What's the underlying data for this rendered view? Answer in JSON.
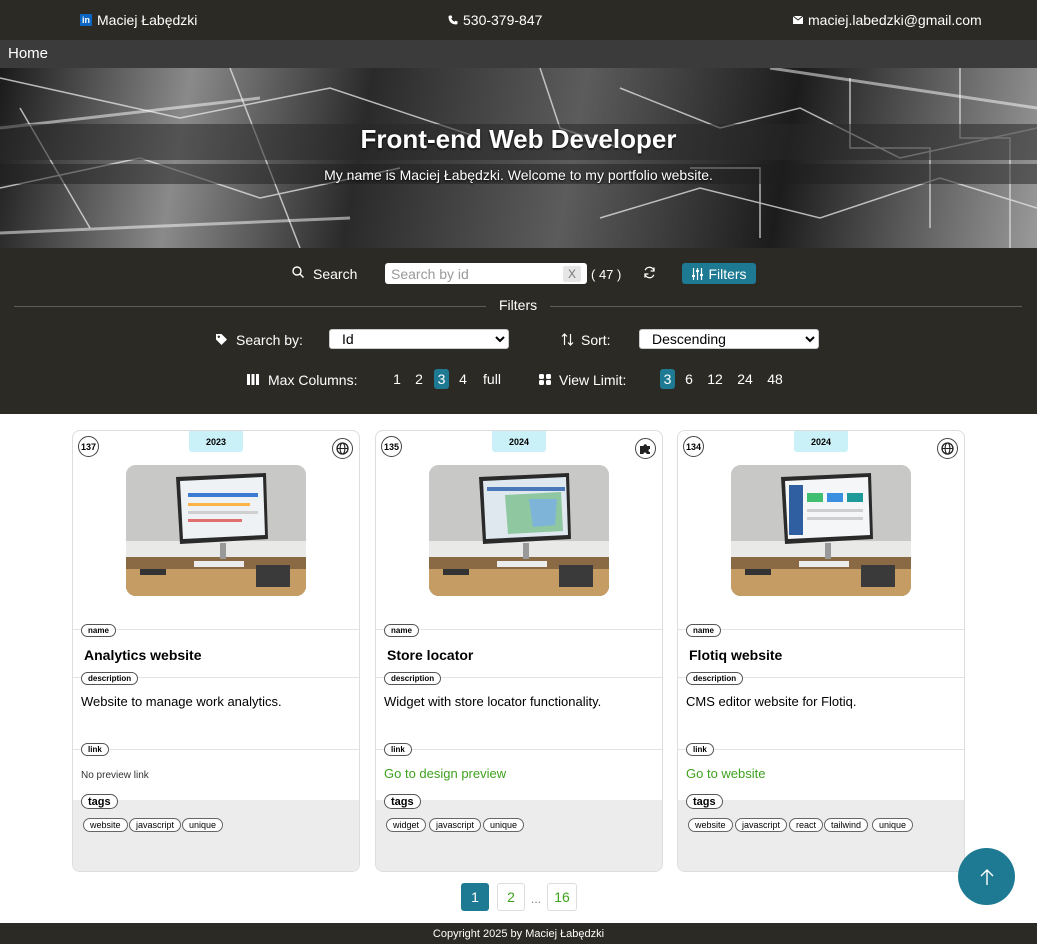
{
  "topbar": {
    "linkedin_icon": "linkedin-icon",
    "name": "Maciej Łabędzki",
    "phone_icon": "phone-icon",
    "phone": "530-379-847",
    "mail_icon": "envelope-icon",
    "email": "maciej.labedzki@gmail.com"
  },
  "nav": {
    "home": "Home"
  },
  "hero": {
    "title": "Front-end Web Developer",
    "subtitle": "My name is Maciej Łabędzki. Welcome to my portfolio website."
  },
  "controls": {
    "search_label": "Search",
    "search_placeholder": "Search by id",
    "clear_label": "X",
    "count": "( 47 )",
    "filters_button": "Filters",
    "filters_heading": "Filters",
    "search_by_label": "Search by:",
    "search_by_value": "Id",
    "sort_label": "Sort:",
    "sort_value": "Descending",
    "max_columns_label": "Max Columns:",
    "max_columns_options": [
      "1",
      "2",
      "3",
      "4",
      "full"
    ],
    "max_columns_selected": "3",
    "view_limit_label": "View Limit:",
    "view_limit_options": [
      "3",
      "6",
      "12",
      "24",
      "48"
    ],
    "view_limit_selected": "3"
  },
  "field_labels": {
    "name": "name",
    "description": "description",
    "link": "link",
    "tags": "tags"
  },
  "cards": [
    {
      "id": "137",
      "year": "2023",
      "type_icon": "globe-icon",
      "name": "Analytics website",
      "description": "Website to manage work analytics.",
      "link": "No preview link",
      "has_link": false,
      "tags": [
        "website",
        "javascript",
        "unique"
      ]
    },
    {
      "id": "135",
      "year": "2024",
      "type_icon": "puzzle-icon",
      "name": "Store locator",
      "description": "Widget with store locator functionality.",
      "link": "Go to design preview",
      "has_link": true,
      "tags": [
        "widget",
        "javascript",
        "unique"
      ]
    },
    {
      "id": "134",
      "year": "2024",
      "type_icon": "globe-icon",
      "name": "Flotiq website",
      "description": "CMS editor website for Flotiq.",
      "link": "Go to website",
      "has_link": true,
      "tags": [
        "website",
        "javascript",
        "react",
        "tailwind",
        "unique"
      ]
    }
  ],
  "pagination": {
    "current": "1",
    "next": "2",
    "ellipsis": "...",
    "last": "16"
  },
  "footer": {
    "copyright": "Copyright 2025 by Maciej Łabędzki"
  },
  "colors": {
    "dark": "#2b2a24",
    "accent": "#1e7a93",
    "link": "#3ea21e",
    "year_badge": "#c9f1f7"
  }
}
